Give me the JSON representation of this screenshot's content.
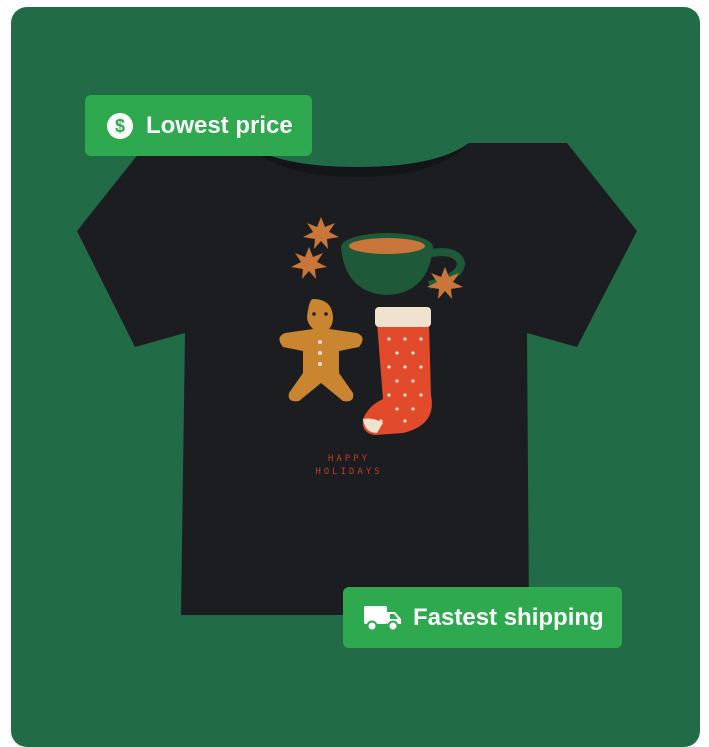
{
  "badges": {
    "price": {
      "label": "Lowest price",
      "icon": "dollar-circle-icon"
    },
    "shipping": {
      "label": "Fastest shipping",
      "icon": "truck-icon"
    }
  },
  "product": {
    "shirt_print_text": [
      "HAPPY",
      "HOLIDAYS"
    ]
  },
  "colors": {
    "card_background": "#216c47",
    "badge_background": "#2ea94f",
    "badge_text": "#ffffff",
    "shirt": "#1c1d20"
  }
}
